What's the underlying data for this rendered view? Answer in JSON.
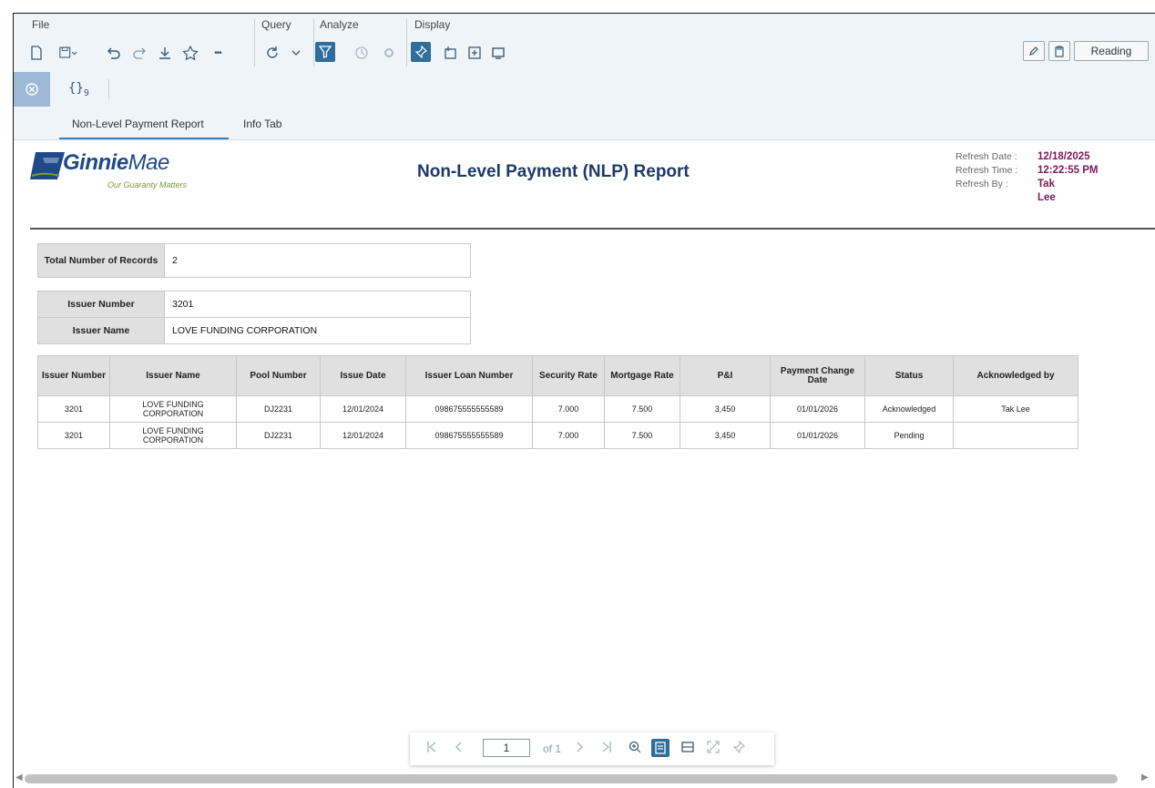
{
  "toolbar": {
    "groups": {
      "file": "File",
      "query": "Query",
      "analyze": "Analyze",
      "display": "Display"
    },
    "reading_label": "Reading",
    "more_glyph": "•••"
  },
  "toolbar2": {
    "variables_label": "{}",
    "variables_count": "9"
  },
  "tabs": [
    {
      "label": "Non-Level Payment Report"
    },
    {
      "label": "Info Tab"
    }
  ],
  "report": {
    "logo": {
      "name_bold": "Ginnie",
      "name_light": "Mae",
      "tagline": "Our Guaranty Matters"
    },
    "title": "Non-Level Payment (NLP) Report",
    "refresh": {
      "date_label": "Refresh Date :",
      "date_value": "12/18/2025",
      "time_label": "Refresh Time :",
      "time_value": "12:22:55 PM",
      "by_label": "Refresh By :",
      "by_value_1": "Tak",
      "by_value_2": "Lee"
    },
    "summary": {
      "total_label": "Total Number of Records",
      "total_value": "2",
      "issuer_number_label": "Issuer Number",
      "issuer_number_value": "3201",
      "issuer_name_label": "Issuer Name",
      "issuer_name_value": "LOVE FUNDING CORPORATION"
    },
    "table": {
      "columns": [
        "Issuer Number",
        "Issuer Name",
        "Pool Number",
        "Issue Date",
        "Issuer Loan Number",
        "Security Rate",
        "Mortgage Rate",
        "P&I",
        "Payment Change Date",
        "Status",
        "Acknowledged by"
      ],
      "rows": [
        [
          "3201",
          "LOVE FUNDING CORPORATION",
          "DJ2231",
          "12/01/2024",
          "098675555555589",
          "7.000",
          "7.500",
          "3,450",
          "01/01/2026",
          "Acknowledged",
          "Tak Lee"
        ],
        [
          "3201",
          "LOVE FUNDING CORPORATION",
          "DJ2231",
          "12/01/2024",
          "098675555555589",
          "7.000",
          "7.500",
          "3,450",
          "01/01/2026",
          "Pending",
          ""
        ]
      ]
    }
  },
  "pagination": {
    "current_page": "1",
    "of_label": "of 1"
  },
  "colors": {
    "accent": "#2f6d9b",
    "toolbar_bg": "#eff4f8",
    "title": "#1f3a68",
    "refresh_value": "#7a1a5a"
  }
}
